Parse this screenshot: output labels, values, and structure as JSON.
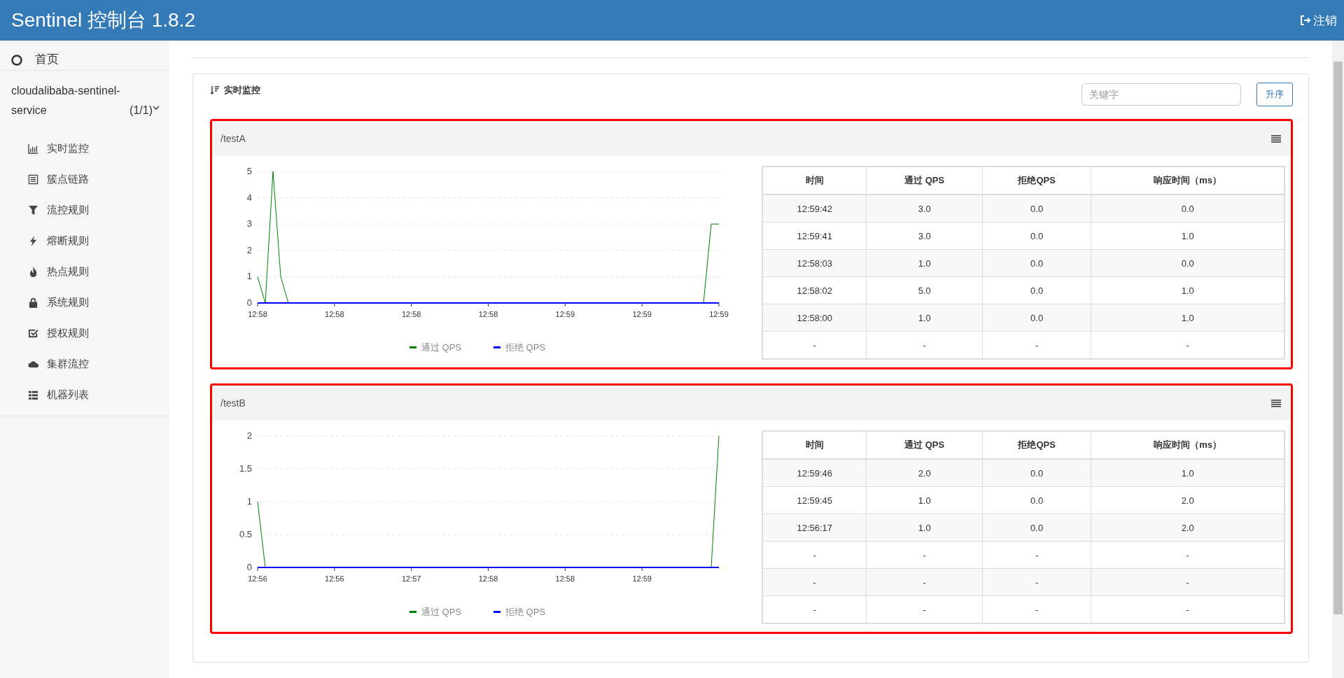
{
  "header": {
    "title": "Sentinel 控制台 1.8.2",
    "logout": "注销"
  },
  "sidebar": {
    "home": "首页",
    "app": {
      "name": "cloudalibaba-sentinel-service",
      "count": "(1/1)",
      "expanded": true
    },
    "items": [
      {
        "label": "实时监控",
        "kind": "bars"
      },
      {
        "label": "簇点链路",
        "kind": "list"
      },
      {
        "label": "流控规则",
        "kind": "filter"
      },
      {
        "label": "熔断规则",
        "kind": "bolt"
      },
      {
        "label": "热点规则",
        "kind": "fire"
      },
      {
        "label": "系统规则",
        "kind": "lock"
      },
      {
        "label": "授权规则",
        "kind": "check"
      },
      {
        "label": "集群流控",
        "kind": "cloud"
      },
      {
        "label": "机器列表",
        "kind": "table"
      }
    ]
  },
  "panel": {
    "title": "实时监控",
    "search": {
      "placeholder": "关键字"
    },
    "sort_button": "升序"
  },
  "resources": [
    {
      "name": "/testA",
      "chart_data": {
        "type": "line",
        "grid": true,
        "legend": "bottom",
        "ylim": [
          0,
          5
        ],
        "yticks": [
          0,
          1,
          2,
          3,
          4,
          5
        ],
        "categories": [
          "12:58",
          null,
          null,
          null,
          null,
          null,
          null,
          null,
          null,
          null,
          "12:58",
          null,
          null,
          null,
          null,
          null,
          null,
          null,
          null,
          null,
          "12:58",
          null,
          null,
          null,
          null,
          null,
          null,
          null,
          null,
          null,
          "12:58",
          null,
          null,
          null,
          null,
          null,
          null,
          null,
          null,
          null,
          "12:59",
          null,
          null,
          null,
          null,
          null,
          null,
          null,
          null,
          null,
          "12:59",
          null,
          null,
          null,
          null,
          null,
          null,
          null,
          null,
          null,
          "12:59"
        ],
        "series": [
          {
            "name": "通过 QPS",
            "color": "#008000",
            "values": [
              1,
              0,
              5,
              1,
              0,
              null,
              null,
              null,
              null,
              null,
              null,
              null,
              null,
              null,
              null,
              null,
              null,
              null,
              null,
              null,
              null,
              null,
              null,
              null,
              null,
              null,
              null,
              null,
              null,
              null,
              null,
              null,
              null,
              null,
              null,
              null,
              null,
              null,
              null,
              null,
              null,
              null,
              null,
              null,
              null,
              null,
              null,
              null,
              null,
              null,
              null,
              null,
              null,
              null,
              null,
              null,
              null,
              null,
              0,
              3,
              3
            ]
          },
          {
            "name": "拒绝 QPS",
            "color": "#0000ff",
            "values": [
              0,
              0,
              0,
              0,
              0,
              0,
              0,
              0,
              0,
              0,
              0,
              0,
              0,
              0,
              0,
              0,
              0,
              0,
              0,
              0,
              0,
              0,
              0,
              0,
              0,
              0,
              0,
              0,
              0,
              0,
              0,
              0,
              0,
              0,
              0,
              0,
              0,
              0,
              0,
              0,
              0,
              0,
              0,
              0,
              0,
              0,
              0,
              0,
              0,
              0,
              0,
              0,
              0,
              0,
              0,
              0,
              0,
              0,
              0,
              0,
              0
            ]
          }
        ]
      },
      "table": {
        "columns": [
          "时间",
          "通过 QPS",
          "拒绝QPS",
          "响应时间（ms）"
        ],
        "rows": [
          [
            "12:59:42",
            "3.0",
            "0.0",
            "0.0"
          ],
          [
            "12:59:41",
            "3.0",
            "0.0",
            "1.0"
          ],
          [
            "12:58:03",
            "1.0",
            "0.0",
            "0.0"
          ],
          [
            "12:58:02",
            "5.0",
            "0.0",
            "1.0"
          ],
          [
            "12:58:00",
            "1.0",
            "0.0",
            "1.0"
          ],
          [
            "-",
            "-",
            "-",
            "-"
          ]
        ]
      }
    },
    {
      "name": "/testB",
      "chart_data": {
        "type": "line",
        "grid": true,
        "legend": "bottom",
        "ylim": [
          0,
          2
        ],
        "yticks": [
          0,
          0.5,
          1,
          1.5,
          2
        ],
        "categories": [
          "12:56",
          null,
          null,
          null,
          null,
          null,
          null,
          null,
          null,
          null,
          "12:56",
          null,
          null,
          null,
          null,
          null,
          null,
          null,
          null,
          null,
          "12:57",
          null,
          null,
          null,
          null,
          null,
          null,
          null,
          null,
          null,
          "12:58",
          null,
          null,
          null,
          null,
          null,
          null,
          null,
          null,
          null,
          "12:58",
          null,
          null,
          null,
          null,
          null,
          null,
          null,
          null,
          null,
          "12:59",
          null,
          null,
          null,
          null,
          null,
          null,
          null,
          null,
          null,
          null
        ],
        "series": [
          {
            "name": "通过 QPS",
            "color": "#008000",
            "values": [
              1,
              0,
              null,
              null,
              null,
              null,
              null,
              null,
              null,
              null,
              null,
              null,
              null,
              null,
              null,
              null,
              null,
              null,
              null,
              null,
              null,
              null,
              null,
              null,
              null,
              null,
              null,
              null,
              null,
              null,
              null,
              null,
              null,
              null,
              null,
              null,
              null,
              null,
              null,
              null,
              null,
              null,
              null,
              null,
              null,
              null,
              null,
              null,
              null,
              null,
              null,
              null,
              null,
              null,
              null,
              null,
              null,
              null,
              null,
              0,
              2
            ]
          },
          {
            "name": "拒绝 QPS",
            "color": "#0000ff",
            "values": [
              0,
              0,
              0,
              0,
              0,
              0,
              0,
              0,
              0,
              0,
              0,
              0,
              0,
              0,
              0,
              0,
              0,
              0,
              0,
              0,
              0,
              0,
              0,
              0,
              0,
              0,
              0,
              0,
              0,
              0,
              0,
              0,
              0,
              0,
              0,
              0,
              0,
              0,
              0,
              0,
              0,
              0,
              0,
              0,
              0,
              0,
              0,
              0,
              0,
              0,
              0,
              0,
              0,
              0,
              0,
              0,
              0,
              0,
              0,
              0,
              0
            ]
          }
        ]
      },
      "table": {
        "columns": [
          "时间",
          "通过 QPS",
          "拒绝QPS",
          "响应时间（ms）"
        ],
        "rows": [
          [
            "12:59:46",
            "2.0",
            "0.0",
            "1.0"
          ],
          [
            "12:59:45",
            "1.0",
            "0.0",
            "2.0"
          ],
          [
            "12:56:17",
            "1.0",
            "0.0",
            "2.0"
          ],
          [
            "-",
            "-",
            "-",
            "-"
          ],
          [
            "-",
            "-",
            "-",
            "-"
          ],
          [
            "-",
            "-",
            "-",
            "-"
          ]
        ]
      }
    }
  ]
}
